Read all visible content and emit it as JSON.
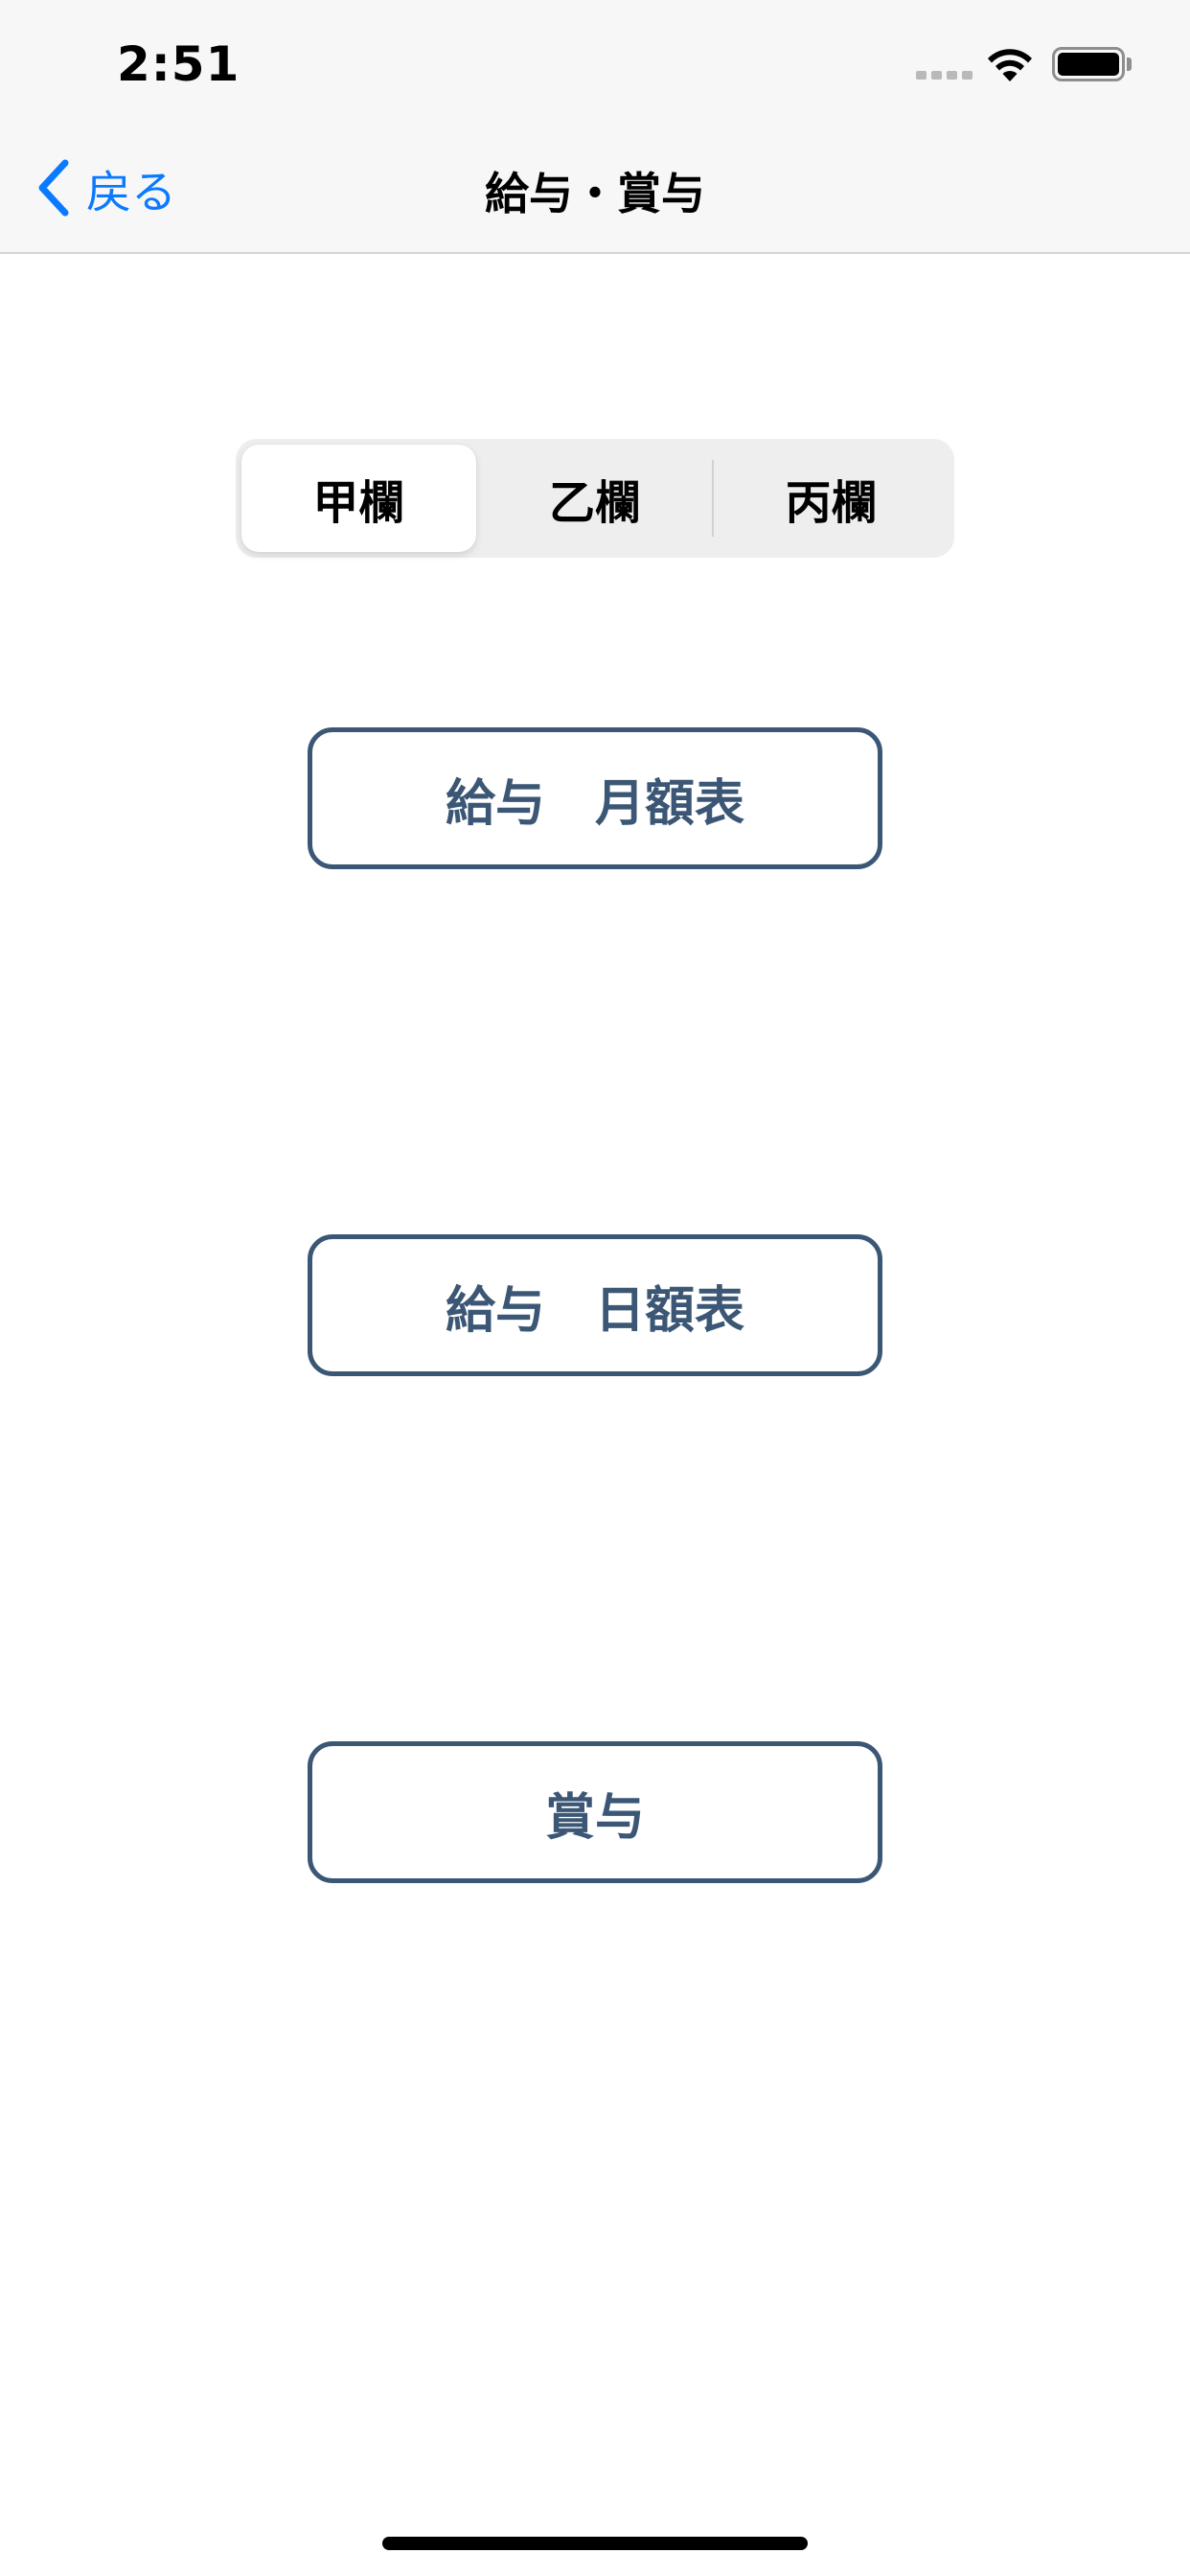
{
  "status_bar": {
    "time": "2:51"
  },
  "nav": {
    "back_label": "戻る",
    "title": "給与・賞与"
  },
  "segmented_control": {
    "segments": [
      "甲欄",
      "乙欄",
      "丙欄"
    ],
    "selected_index": 0
  },
  "buttons": {
    "monthly_table": "給与　月額表",
    "daily_table": "給与　日額表",
    "bonus": "賞与"
  },
  "colors": {
    "accent": "#0a7aff",
    "button_outline": "#3b5775",
    "bar_background": "#f7f7f7",
    "segment_background": "#eeeeef"
  },
  "icons": {
    "back": "chevron-left-icon",
    "wifi": "wifi-icon",
    "battery": "battery-icon",
    "signal": "cellular-signal-icon"
  }
}
